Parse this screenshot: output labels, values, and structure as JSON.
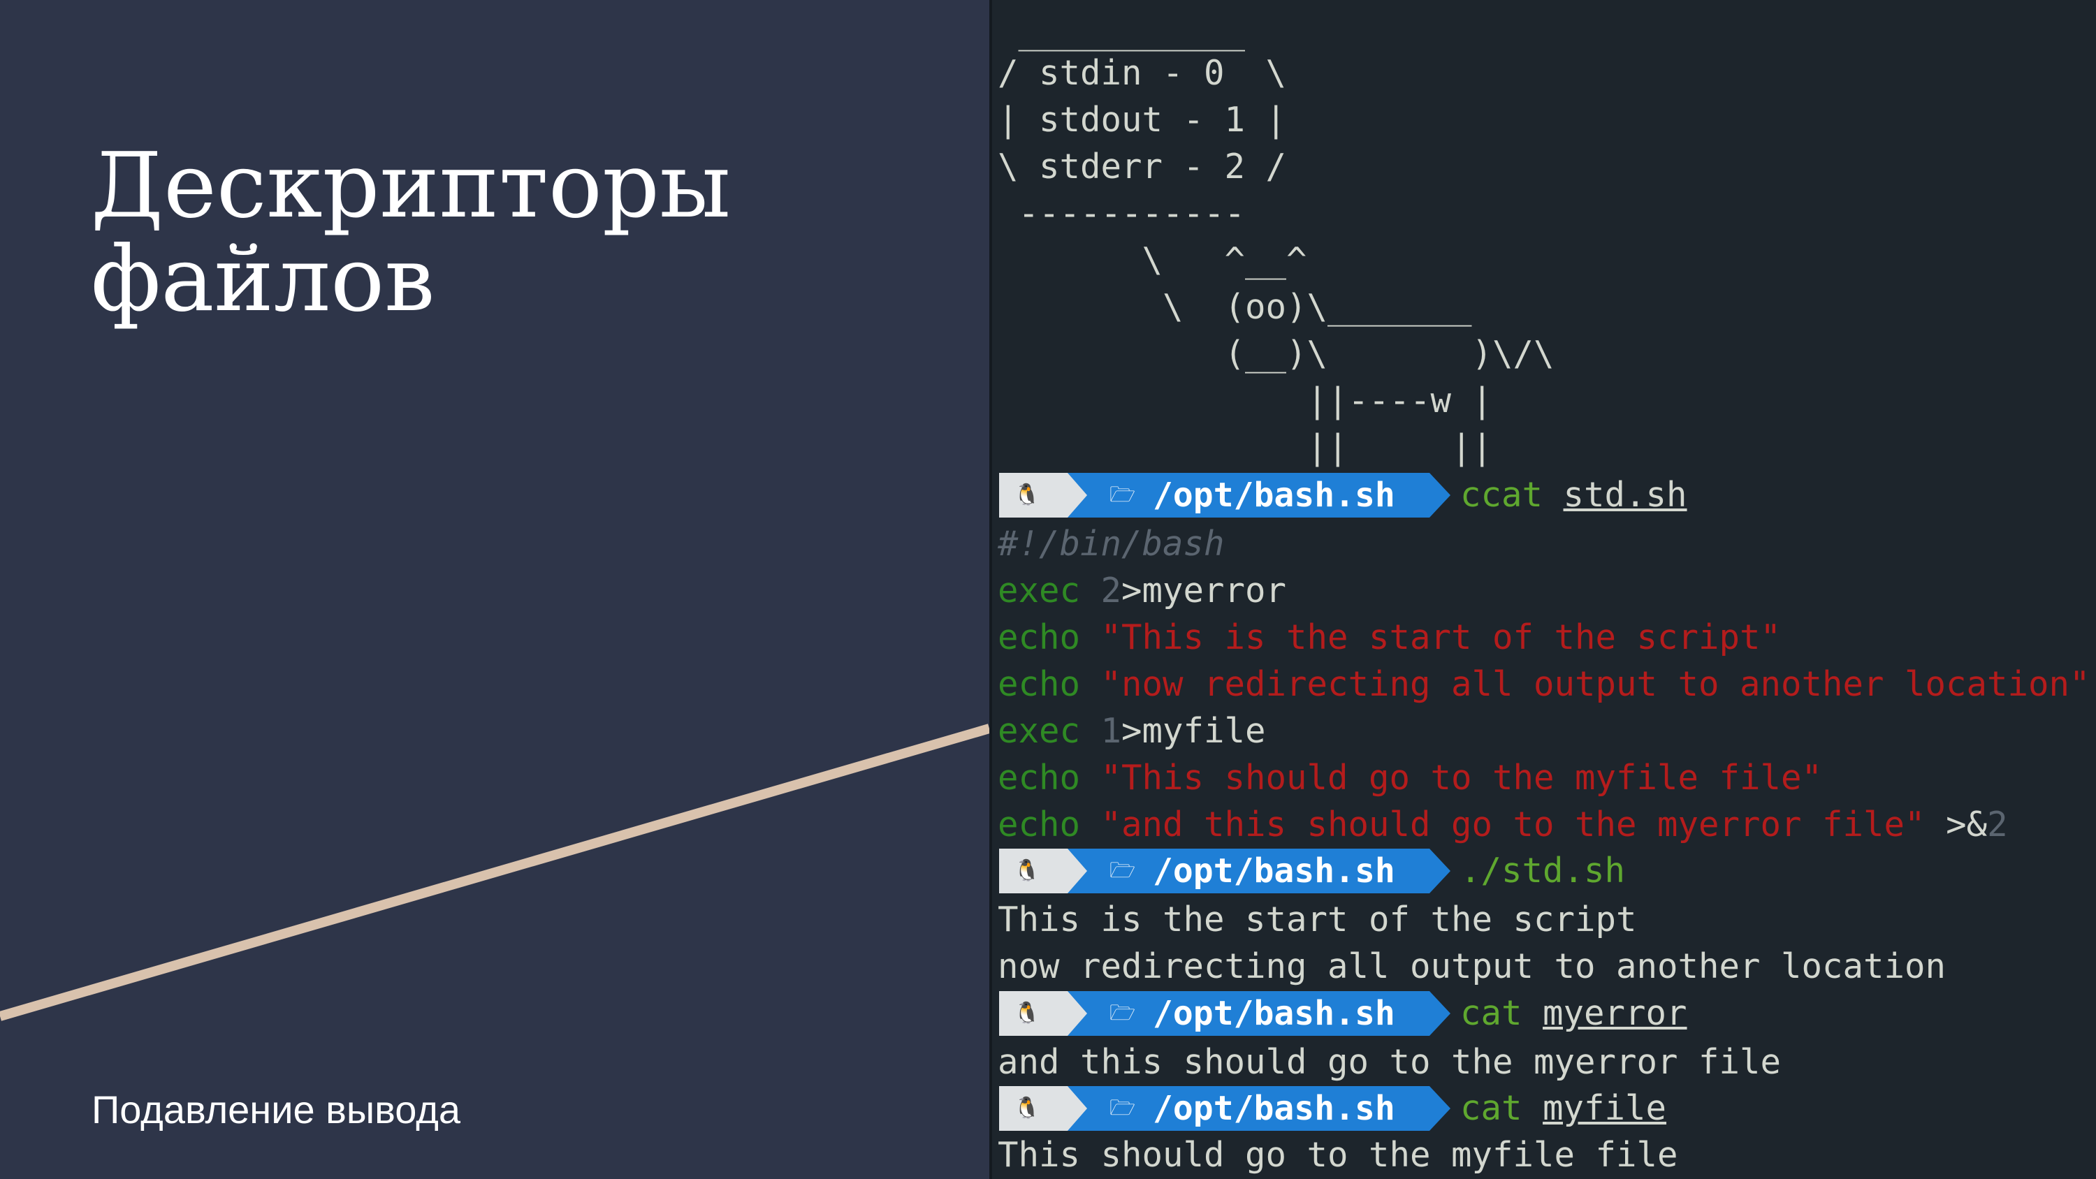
{
  "slide": {
    "title_line1": "Дескрипторы",
    "title_line2": "файлов",
    "subtitle": "Подавление вывода",
    "accent_color": "#d9c2ad",
    "background_color": "#2e3549"
  },
  "terminal": {
    "cowsay": [
      " ___________",
      "/ stdin - 0  \\",
      "| stdout - 1 |",
      "\\ stderr - 2 /",
      " -----------",
      "       \\   ^__^",
      "        \\  (oo)\\_______",
      "           (__)\\       )\\/\\",
      "               ||----w |",
      "               ||     ||"
    ],
    "prompts": [
      {
        "os_icon": "tux-icon",
        "folder_icon": "folder-icon",
        "path": "/opt/bash.sh",
        "cmd": "ccat",
        "arg": "std.sh"
      },
      {
        "os_icon": "tux-icon",
        "folder_icon": "folder-icon",
        "path": "/opt/bash.sh",
        "cmd": "./std.sh",
        "arg": ""
      },
      {
        "os_icon": "tux-icon",
        "folder_icon": "folder-icon",
        "path": "/opt/bash.sh",
        "cmd": "cat",
        "arg": "myerror"
      },
      {
        "os_icon": "tux-icon",
        "folder_icon": "folder-icon",
        "path": "/opt/bash.sh",
        "cmd": "cat",
        "arg": "myfile"
      }
    ],
    "script": {
      "shebang": "#!/bin/bash",
      "line1": {
        "kw": "exec",
        "fd": "2",
        "rest": ">myerror"
      },
      "line2": {
        "kw": "echo",
        "str": "\"This is the start of the script\""
      },
      "line3": {
        "kw": "echo",
        "str": "\"now redirecting all output to another location\""
      },
      "line4": {
        "kw": "exec",
        "fd": "1",
        "rest": ">myfile"
      },
      "line5": {
        "kw": "echo",
        "str": "\"This should go to the myfile file\""
      },
      "line6": {
        "kw": "echo",
        "str": "\"and this should go to the myerror file\"",
        "redir": ">&",
        "fd": "2"
      }
    },
    "outputs": {
      "run1": "This is the start of the script",
      "run2": "now redirecting all output to another location",
      "myerror": "and this should go to the myerror file",
      "myfile": "This should go to the myfile file"
    }
  }
}
